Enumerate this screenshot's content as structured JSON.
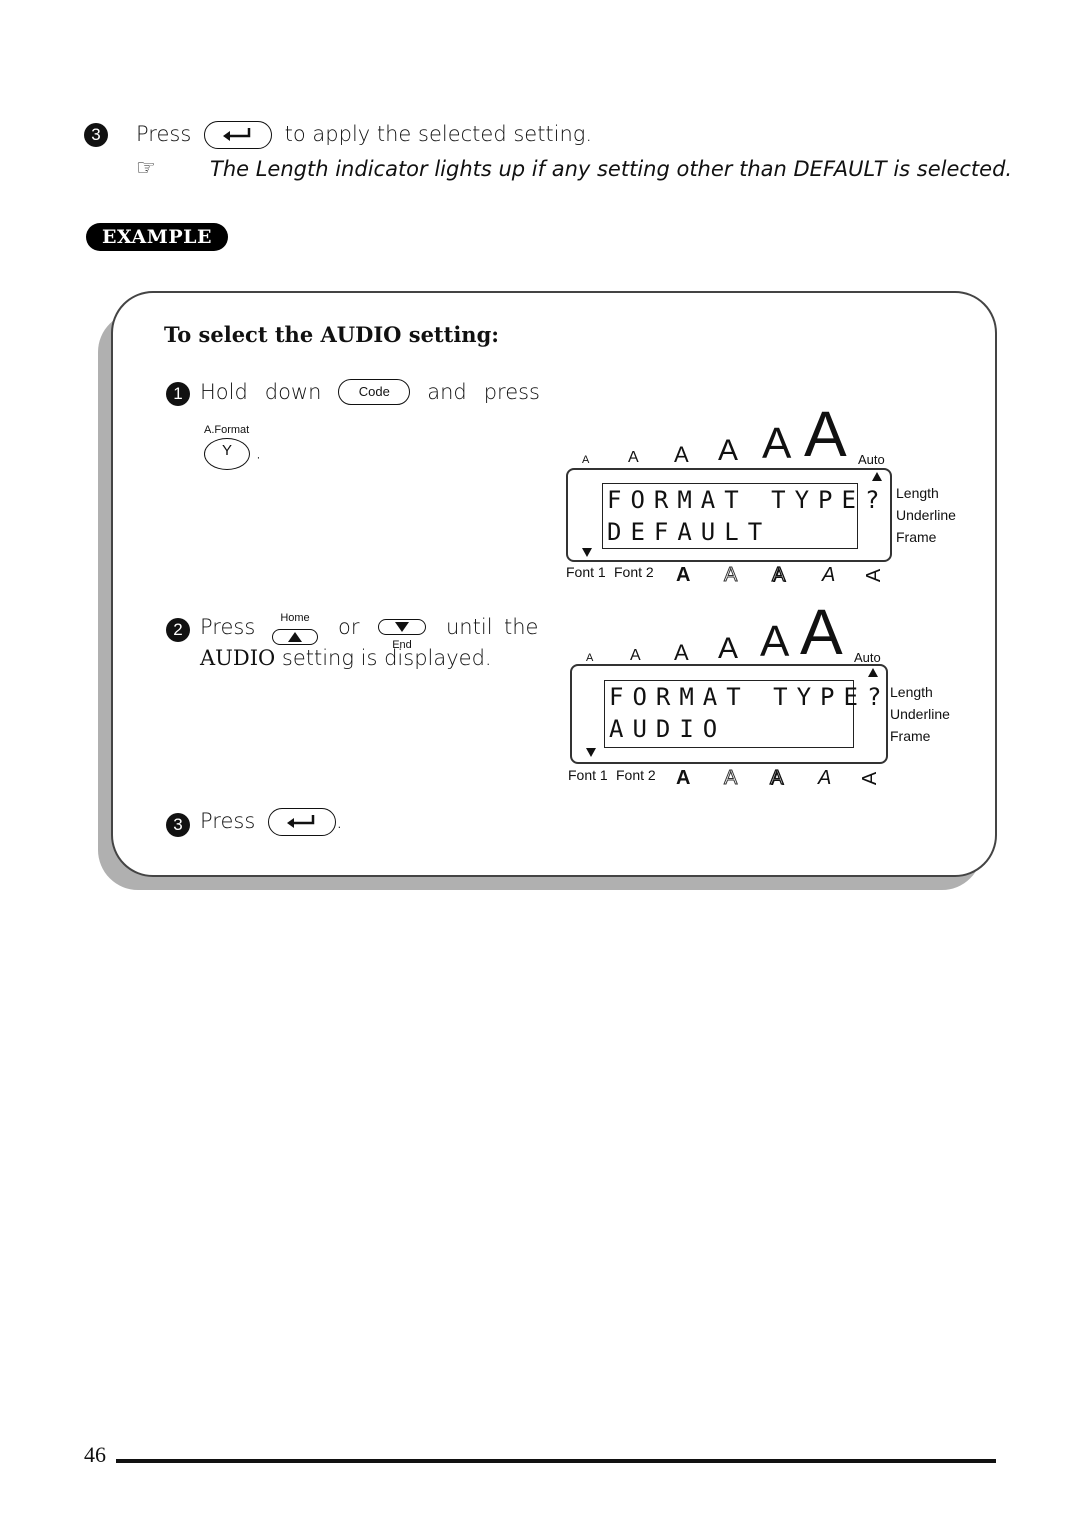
{
  "step3_intro": {
    "number": "3",
    "press": "Press",
    "rest": "to apply the selected setting."
  },
  "note": {
    "icon": "pointing-hand-icon",
    "glyph": "☞",
    "part1": "The ",
    "bold1": "Length",
    "part2": " indicator lights up if any setting other than ",
    "bold2": "DEFAULT",
    "part3": " is selected."
  },
  "example_badge": "EXAMPLE",
  "example": {
    "heading": "To select the AUDIO setting:",
    "step1": {
      "number": "1",
      "hold": "Hold",
      "down": "down",
      "code_key": "Code",
      "and": "and",
      "press": "press",
      "y_key_label": "A.Format",
      "y_key": "Y",
      "period": "."
    },
    "step2": {
      "number": "2",
      "press": "Press",
      "home_label": "Home",
      "or": "or",
      "end_label": "End",
      "until": "until",
      "the": "the",
      "bold": "AUDIO",
      "rest": " setting is displayed."
    },
    "step3": {
      "number": "3",
      "press": "Press",
      "period": "."
    },
    "lcd_displays": [
      {
        "size_letters": [
          "A",
          "A",
          "A",
          "A",
          "A",
          "A"
        ],
        "auto": "Auto",
        "line1": "FORMAT TYPE?",
        "line2": "DEFAULT",
        "side_labels": [
          "Length",
          "Underline",
          "Frame"
        ],
        "font1": "Font 1",
        "font2": "Font 2",
        "style_glyphs": [
          "A",
          "A",
          "A",
          "A",
          "A"
        ]
      },
      {
        "size_letters": [
          "A",
          "A",
          "A",
          "A",
          "A",
          "A"
        ],
        "auto": "Auto",
        "line1": "FORMAT TYPE?",
        "line2": "AUDIO",
        "side_labels": [
          "Length",
          "Underline",
          "Frame"
        ],
        "font1": "Font 1",
        "font2": "Font 2",
        "style_glyphs": [
          "A",
          "A",
          "A",
          "A",
          "A"
        ]
      }
    ]
  },
  "footer": {
    "page_number": "46"
  }
}
